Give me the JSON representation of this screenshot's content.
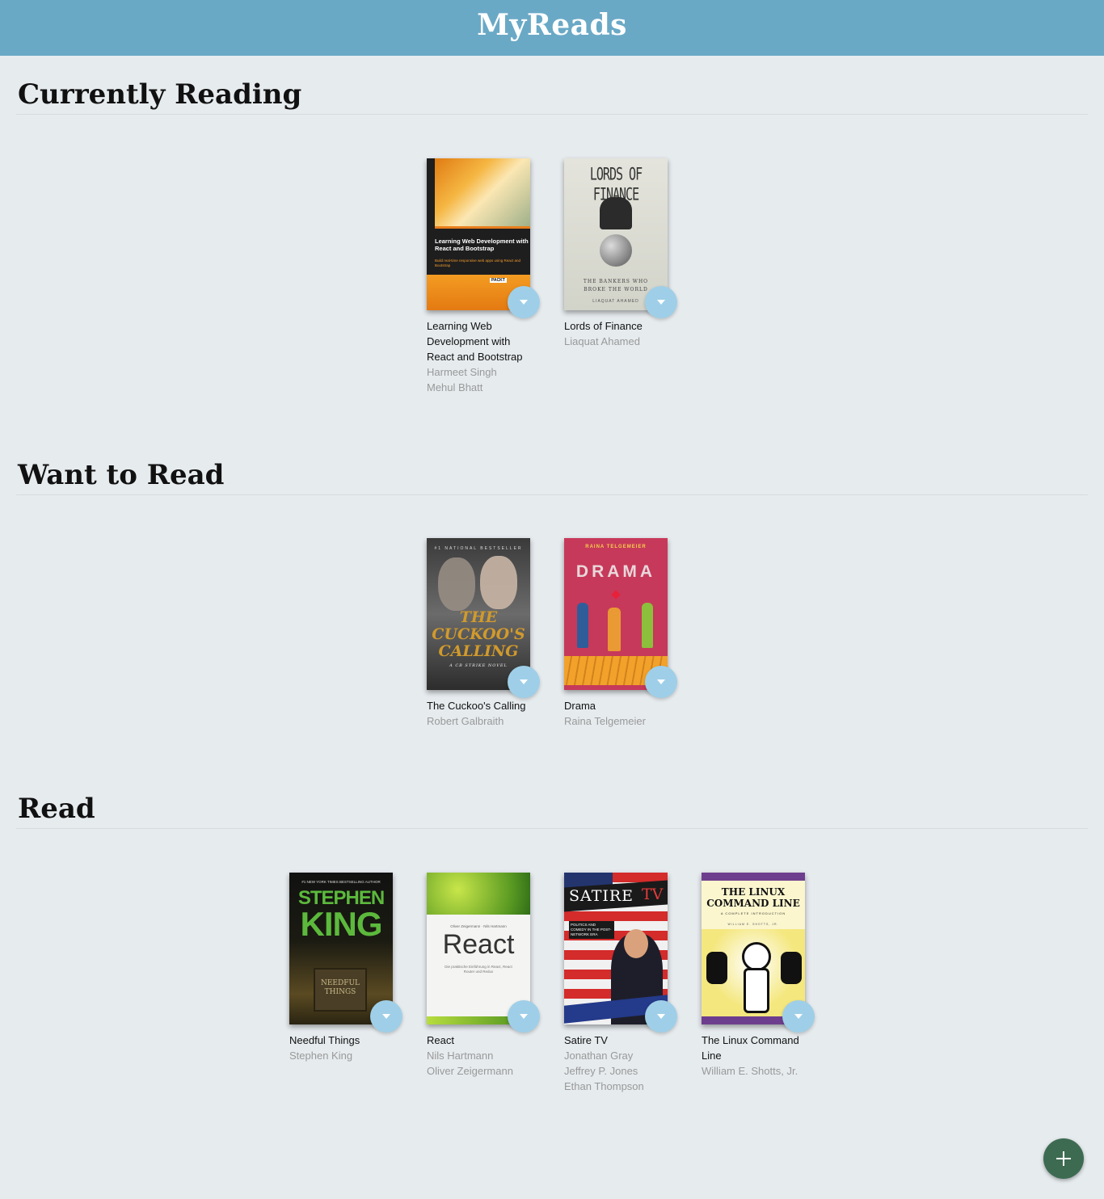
{
  "header": {
    "title": "MyReads"
  },
  "shelves": [
    {
      "title": "Currently Reading",
      "books": [
        {
          "title": "Learning Web Development with React and Bootstrap",
          "authors": [
            "Harmeet Singh",
            "Mehul Bhatt"
          ],
          "cover": {
            "headline": "Learning Web Development with React and Bootstrap",
            "tagline": "Build real-time responsive web apps using React and Bootstrap",
            "publisher": "PACKT"
          }
        },
        {
          "title": "Lords of Finance",
          "authors": [
            "Liaquat Ahamed"
          ],
          "cover": {
            "headline": "LORDS OF FINANCE",
            "subtitle": "THE BANKERS WHO BROKE THE WORLD",
            "author": "LIAQUAT AHAMED"
          }
        }
      ]
    },
    {
      "title": "Want to Read",
      "books": [
        {
          "title": "The Cuckoo's Calling",
          "authors": [
            "Robert Galbraith"
          ],
          "cover": {
            "banner": "#1 NATIONAL BESTSELLER",
            "headline": "THE CUCKOO'S CALLING",
            "subtitle": "A CB STRIKE NOVEL"
          }
        },
        {
          "title": "Drama",
          "authors": [
            "Raina Telgemeier"
          ],
          "cover": {
            "author": "RAINA TELGEMEIER",
            "headline": "DRAMA"
          }
        }
      ]
    },
    {
      "title": "Read",
      "books": [
        {
          "title": "Needful Things",
          "authors": [
            "Stephen King"
          ],
          "cover": {
            "banner": "#1 NEW YORK TIMES BESTSELLING AUTHOR",
            "author_first": "STEPHEN",
            "author_last": "KING",
            "sign": "NEEDFUL THINGS"
          }
        },
        {
          "title": "React",
          "authors": [
            "Nils Hartmann",
            "Oliver Zeigermann"
          ],
          "cover": {
            "authors": "Oliver Zeigermann · Nils Hartmann",
            "headline": "React",
            "tagline": "Die praktische Einführung in React, React Router und Redux"
          }
        },
        {
          "title": "Satire TV",
          "authors": [
            "Jonathan Gray",
            "Jeffrey P. Jones",
            "Ethan Thompson"
          ],
          "cover": {
            "headline": "SATIRE",
            "headline2": "TV",
            "subtitle": "POLITICS AND COMEDY IN THE POST-NETWORK ERA"
          }
        },
        {
          "title": "The Linux Command Line",
          "authors": [
            "William E. Shotts, Jr."
          ],
          "cover": {
            "headline": "THE LINUX COMMAND LINE",
            "subtitle": "A COMPLETE INTRODUCTION",
            "author": "WILLIAM E. SHOTTS, JR."
          }
        }
      ]
    }
  ],
  "icons": {
    "shelf_changer": "dropdown-arrow-icon",
    "add": "plus-icon"
  },
  "colors": {
    "header": "#6aa9c6",
    "background": "#e6ebee",
    "shelf_changer": "#9fcfe8",
    "add_button": "#3d6b52"
  }
}
